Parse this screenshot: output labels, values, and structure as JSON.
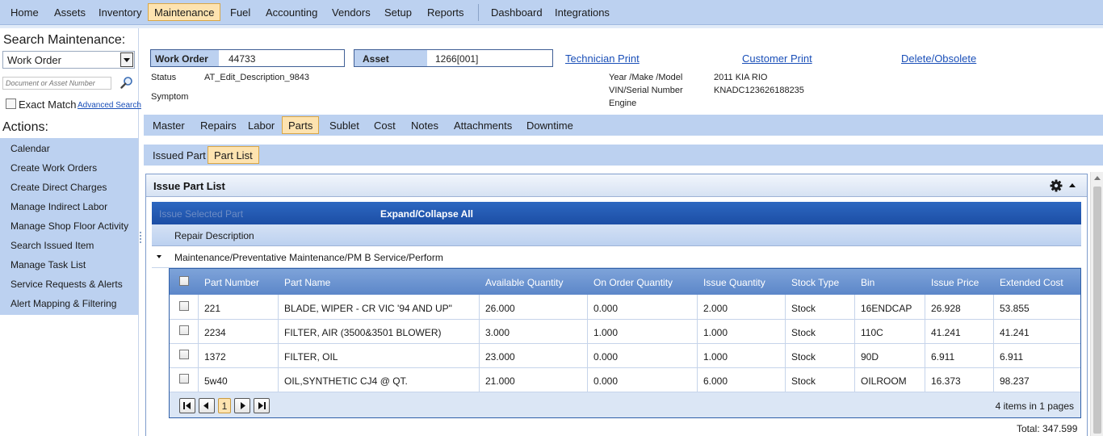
{
  "topmenu": {
    "items": [
      "Home",
      "Assets",
      "Inventory",
      "Maintenance",
      "Fuel",
      "Accounting",
      "Vendors",
      "Setup",
      "Reports",
      "Dashboard",
      "Integrations"
    ],
    "active": "Maintenance"
  },
  "sidebar": {
    "title": "Search Maintenance:",
    "search_type": "Work Order",
    "search_placeholder": "Document or Asset Number",
    "exact_match_label": "Exact Match",
    "advanced_search_label": "Advanced Search",
    "actions_title": "Actions:",
    "actions": [
      "Calendar",
      "Create Work Orders",
      "Create Direct Charges",
      "Manage Indirect Labor",
      "Manage Shop Floor Activity",
      "Search Issued Item",
      "Manage Task List",
      "Service Requests & Alerts",
      "Alert Mapping & Filtering"
    ]
  },
  "header": {
    "work_order_label": "Work Order",
    "work_order_value": "44733",
    "asset_label": "Asset",
    "asset_value": "1266[001]",
    "links": [
      "Technician Print",
      "Customer Print",
      "Delete/Obsolete"
    ],
    "status_label": "Status",
    "status_value": "AT_Edit_Description_9843",
    "symptom_label": "Symptom",
    "ymm_label": "Year /Make /Model",
    "ymm_value": "2011 KIA RIO",
    "vin_label": "VIN/Serial Number",
    "vin_value": "KNADC123626188235",
    "engine_label": "Engine"
  },
  "tabs": {
    "items": [
      "Master",
      "Repairs",
      "Labor",
      "Parts",
      "Sublet",
      "Cost",
      "Notes",
      "Attachments",
      "Downtime"
    ],
    "active": "Parts"
  },
  "subtabs": {
    "items": [
      "Issued Part",
      "Part List"
    ],
    "active": "Part List"
  },
  "panel": {
    "title": "Issue Part List",
    "toolbar": {
      "issue_selected": "Issue Selected Part",
      "expand_collapse": "Expand/Collapse All"
    },
    "group_header": "Repair Description",
    "group_row": "Maintenance/Preventative Maintenance/PM B Service/Perform",
    "columns": [
      "Part Number",
      "Part Name",
      "Available Quantity",
      "On Order Quantity",
      "Issue Quantity",
      "Stock Type",
      "Bin",
      "Issue Price",
      "Extended Cost"
    ],
    "rows": [
      [
        "221",
        "BLADE, WIPER - CR VIC '94 AND UP\"",
        "26.000",
        "0.000",
        "2.000",
        "Stock",
        "16ENDCAP",
        "26.928",
        "53.855"
      ],
      [
        "2234",
        "FILTER, AIR (3500&3501 BLOWER)",
        "3.000",
        "1.000",
        "1.000",
        "Stock",
        "110C",
        "41.241",
        "41.241"
      ],
      [
        "1372",
        "FILTER, OIL",
        "23.000",
        "0.000",
        "1.000",
        "Stock",
        "90D",
        "6.911",
        "6.911"
      ],
      [
        "5w40",
        "OIL,SYNTHETIC CJ4 @ QT.",
        "21.000",
        "0.000",
        "6.000",
        "Stock",
        "OILROOM",
        "16.373",
        "98.237"
      ]
    ],
    "pager": {
      "current_page": "1",
      "summary": "4 items in 1 pages"
    },
    "total": "Total: 347.599"
  }
}
